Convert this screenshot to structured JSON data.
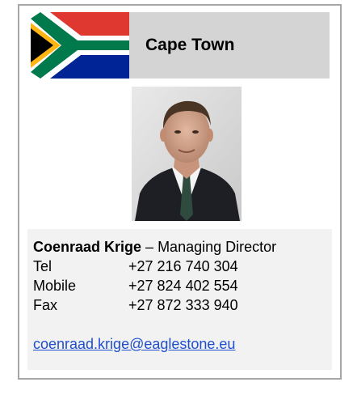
{
  "location": {
    "city": "Cape Town",
    "flag_icon": "south-africa-flag"
  },
  "person": {
    "name": "Coenraad Krige",
    "separator": " – ",
    "title": "Managing Director"
  },
  "contacts": [
    {
      "label": "Tel",
      "value": "+27 216 740 304"
    },
    {
      "label": "Mobile",
      "value": "+27 824 402 554"
    },
    {
      "label": "Fax",
      "value": "+27 872 333 940"
    }
  ],
  "email": "coenraad.krige@eaglestone.eu",
  "colors": {
    "header_bg": "#d4d4d4",
    "info_bg": "#f2f2f2",
    "border": "#a6a6a6",
    "link": "#1f4fd0"
  }
}
